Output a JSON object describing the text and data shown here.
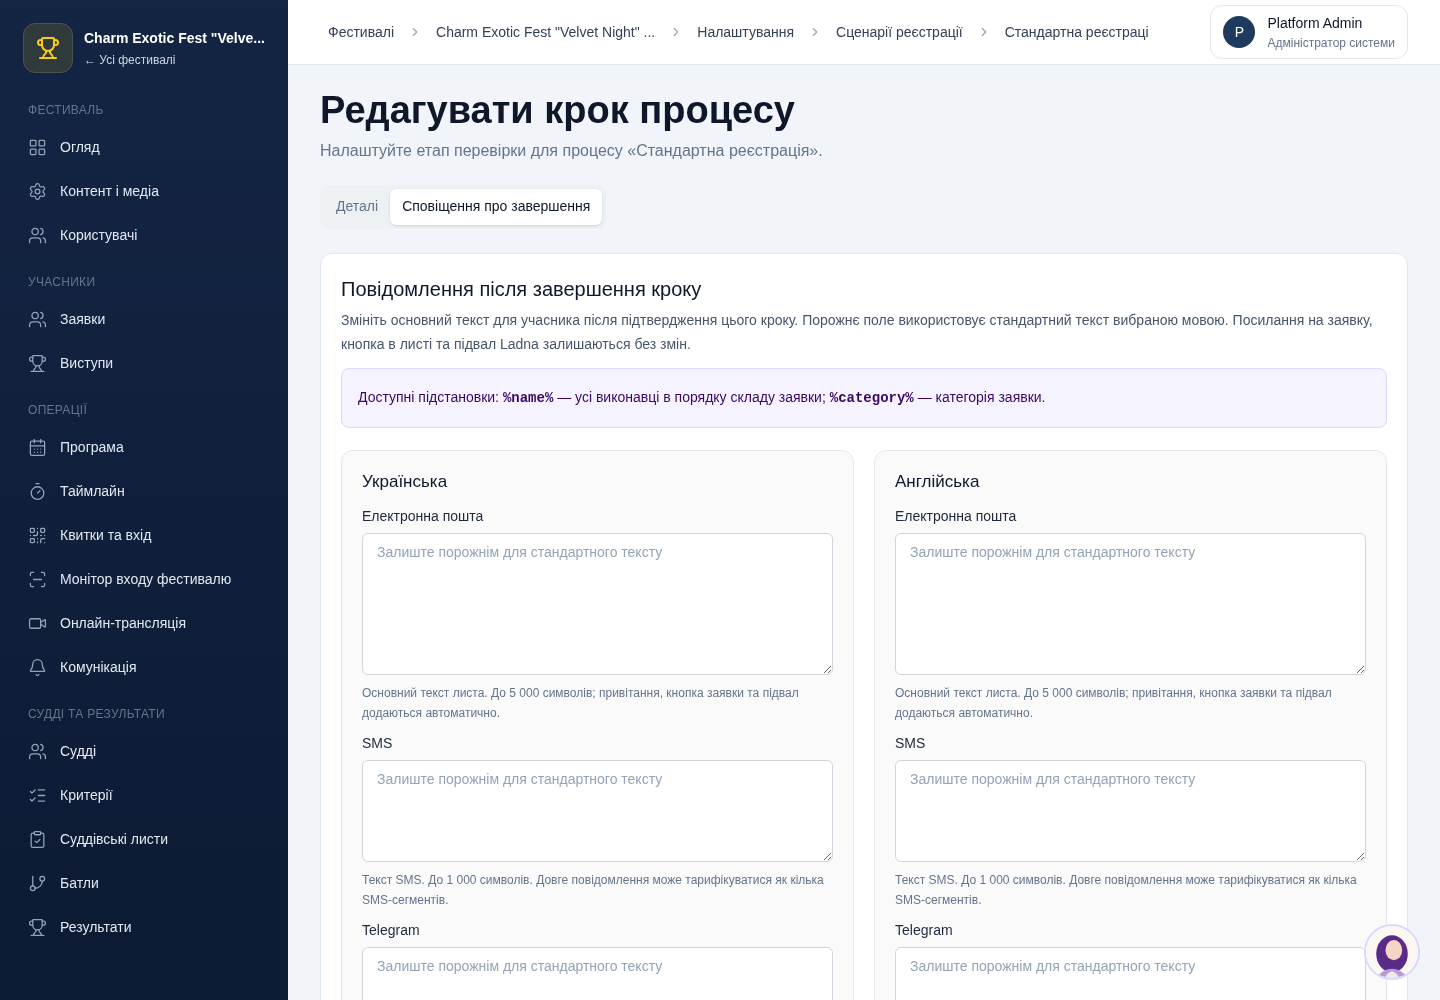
{
  "sidebar": {
    "festival_name": "Charm Exotic Fest \"Velve...",
    "back_link": "← Усі фестивалі",
    "sections": [
      {
        "title": "ФЕСТИВАЛЬ",
        "items": [
          {
            "label": "Огляд"
          },
          {
            "label": "Контент і медіа"
          },
          {
            "label": "Користувачі"
          }
        ]
      },
      {
        "title": "УЧАСНИКИ",
        "items": [
          {
            "label": "Заявки"
          },
          {
            "label": "Виступи"
          }
        ]
      },
      {
        "title": "ОПЕРАЦІЇ",
        "items": [
          {
            "label": "Програма"
          },
          {
            "label": "Таймлайн"
          },
          {
            "label": "Квитки та вхід"
          },
          {
            "label": "Монітор входу фестивалю"
          },
          {
            "label": "Онлайн-трансляція"
          },
          {
            "label": "Комунікація"
          }
        ]
      },
      {
        "title": "СУДДІ ТА РЕЗУЛЬТАТИ",
        "items": [
          {
            "label": "Судді"
          },
          {
            "label": "Критерії"
          },
          {
            "label": "Суддівські листи"
          },
          {
            "label": "Батли"
          },
          {
            "label": "Результати"
          }
        ]
      }
    ]
  },
  "breadcrumbs": [
    "Фестивалі",
    "Charm Exotic Fest \"Velvet Night\" ...",
    "Налаштування",
    "Сценарії реєстрації",
    "Стандартна реєстраці"
  ],
  "user": {
    "initial": "P",
    "name": "Platform Admin",
    "role": "Адміністратор системи"
  },
  "page": {
    "title": "Редагувати крок процесу",
    "subtitle": "Налаштуйте етап перевірки для процесу «Стандартна реєстрація»."
  },
  "tabs": [
    {
      "label": "Деталі",
      "selected": false
    },
    {
      "label": "Сповіщення про завершення",
      "selected": true
    }
  ],
  "card": {
    "title": "Повідомлення після завершення кроку",
    "description": "Змініть основний текст для учасника після підтвердження цього кроку. Порожнє поле використовує стандартний текст вибраною мовою. Посилання на заявку, кнопка в листі та підвал Ladna залишаються без змін.",
    "notice": [
      {
        "kind": "text",
        "text": "Доступні підстановки: "
      },
      {
        "kind": "code",
        "text": "%name%"
      },
      {
        "kind": "text",
        "text": " — усі виконавці в порядку складу заявки; "
      },
      {
        "kind": "code",
        "text": "%category%"
      },
      {
        "kind": "text",
        "text": " — категорія заявки."
      }
    ],
    "languages": [
      {
        "title": "Українська",
        "fields": [
          {
            "label": "Електронна пошта",
            "placeholder": "Залиште порожнім для стандартного тексту",
            "hint": "Основний текст листа. До 5 000 символів; привітання, кнопка заявки та підвал додаються автоматично."
          },
          {
            "label": "SMS",
            "placeholder": "Залиште порожнім для стандартного тексту",
            "hint": "Текст SMS. До 1 000 символів. Довге повідомлення може тарифікуватися як кілька SMS-сегментів."
          },
          {
            "label": "Telegram",
            "placeholder": "Залиште порожнім для стандартного тексту"
          }
        ]
      },
      {
        "title": "Англійська",
        "fields": [
          {
            "label": "Електронна пошта",
            "placeholder": "Залиште порожнім для стандартного тексту",
            "hint": "Основний текст листа. До 5 000 символів; привітання, кнопка заявки та підвал додаються автоматично."
          },
          {
            "label": "SMS",
            "placeholder": "Залиште порожнім для стандартного тексту",
            "hint": "Текст SMS. До 1 000 символів. Довге повідомлення може тарифікуватися як кілька SMS-сегментів."
          },
          {
            "label": "Telegram",
            "placeholder": "Залиште порожнім для стандартного тексту"
          }
        ]
      }
    ]
  }
}
